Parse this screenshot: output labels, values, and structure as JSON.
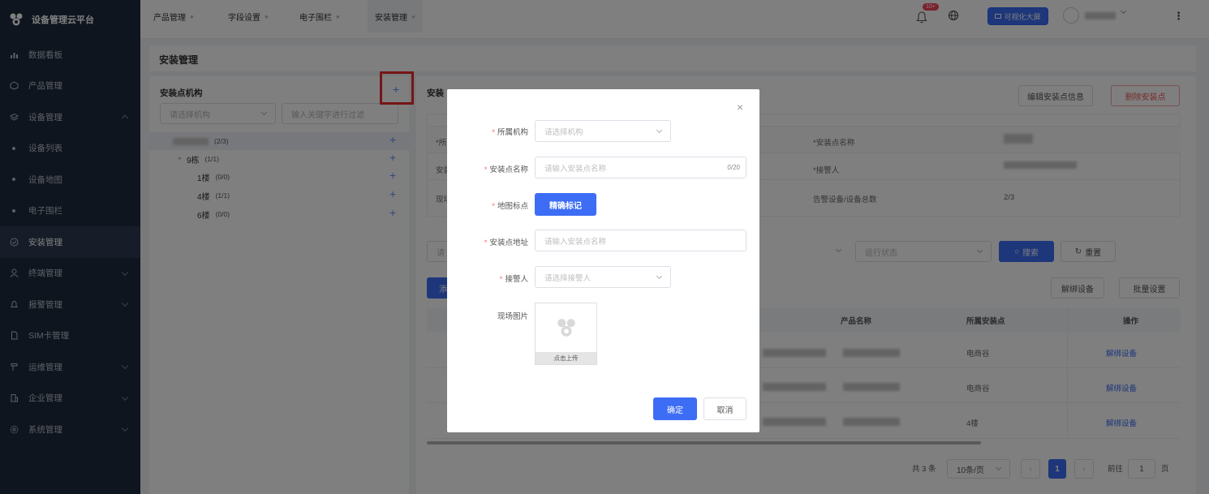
{
  "app": {
    "title": "设备管理云平台"
  },
  "sidebar": {
    "items": [
      {
        "label": "数据看板",
        "icon": "bar-chart-icon"
      },
      {
        "label": "产品管理",
        "icon": "cube-icon"
      },
      {
        "label": "设备管理",
        "icon": "layers-icon",
        "expanded": true
      },
      {
        "label": "设备列表",
        "sub": true
      },
      {
        "label": "设备地图",
        "sub": true
      },
      {
        "label": "电子围栏",
        "sub": true
      },
      {
        "label": "安装管理",
        "icon": "check-circle-icon",
        "active": true
      },
      {
        "label": "终端管理",
        "icon": "user-icon"
      },
      {
        "label": "报警管理",
        "icon": "bell-icon"
      },
      {
        "label": "SIM卡管理",
        "icon": "sim-card-icon"
      },
      {
        "label": "运维管理",
        "icon": "tool-icon"
      },
      {
        "label": "企业管理",
        "icon": "building-icon"
      },
      {
        "label": "系统管理",
        "icon": "settings-icon"
      }
    ]
  },
  "tabs": [
    {
      "label": "产品管理"
    },
    {
      "label": "字段设置"
    },
    {
      "label": "电子围栏"
    },
    {
      "label": "安装管理",
      "active": true
    }
  ],
  "header": {
    "notification_badge": "10+",
    "bigscreen_label": "可视化大屏"
  },
  "page": {
    "title": "安装管理"
  },
  "left": {
    "title": "安装点机构",
    "org_select_placeholder": "请选择机构",
    "filter_placeholder": "输入关键字进行过滤",
    "tree": [
      {
        "label": "",
        "count": "(2/3)",
        "level": 0
      },
      {
        "label": "9栋",
        "count": "(1/1)",
        "level": 1
      },
      {
        "label": "1楼",
        "count": "(0/0)",
        "level": 2
      },
      {
        "label": "4楼",
        "count": "(1/1)",
        "level": 2
      },
      {
        "label": "6楼",
        "count": "(0/0)",
        "level": 2
      }
    ]
  },
  "right": {
    "title": "安装",
    "edit_btn": "编辑安装点信息",
    "delete_btn": "删除安装点",
    "info": {
      "name_label": "*安装点名称",
      "alarm_person_label": "*接警人",
      "device_ratio_label": "告警设备/设备总数",
      "device_ratio_value": "2/3",
      "row_labels": [
        "*所",
        "安装",
        "现场"
      ]
    },
    "filter": {
      "search_prefix": "请",
      "status_placeholder": "运行状态",
      "search_btn": "搜索",
      "reset_btn": "重置"
    },
    "actions": {
      "add_prefix": "添",
      "unbind_btn": "解绑设备",
      "batch_btn": "批量设置"
    },
    "table": {
      "headers": [
        "产品名称",
        "所属安装点",
        "操作"
      ],
      "rows": [
        {
          "location": "电商谷",
          "action": "解绑设备"
        },
        {
          "location": "电商谷",
          "action": "解绑设备"
        },
        {
          "location": "4楼",
          "action": "解绑设备"
        }
      ]
    },
    "pagination": {
      "total": "共 3 条",
      "page_size": "10条/页",
      "current": "1",
      "goto_label": "前往",
      "goto_value": "1",
      "page_suffix": "页"
    }
  },
  "dialog": {
    "fields": {
      "org_label": "所属机构",
      "org_placeholder": "请选择机构",
      "name_label": "安装点名称",
      "name_placeholder": "请输入安装点名称",
      "name_counter": "0/20",
      "map_label": "地图标点",
      "map_btn": "精确标记",
      "address_label": "安装点地址",
      "address_placeholder": "请输入安装点名称",
      "alarm_label": "接警人",
      "alarm_placeholder": "请选择接警人",
      "photo_label": "现场图片",
      "upload_label": "点击上传"
    },
    "confirm": "确定",
    "cancel": "取消"
  }
}
